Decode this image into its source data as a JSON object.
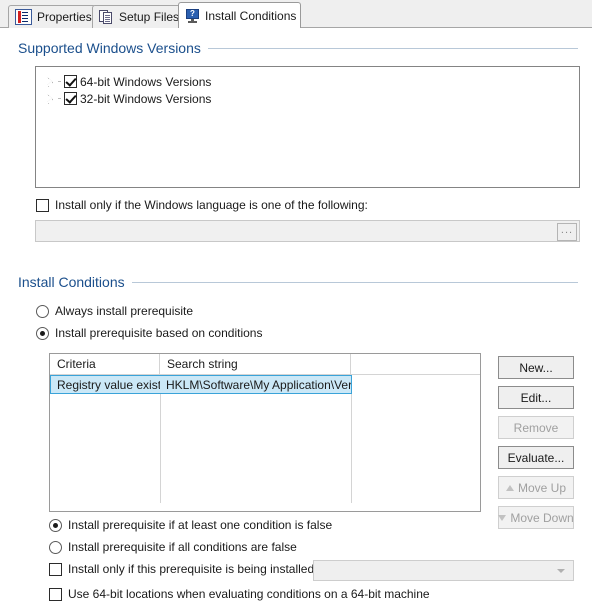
{
  "tabs": [
    {
      "label": "Properties",
      "icon": "properties-icon",
      "active": false
    },
    {
      "label": "Setup Files",
      "icon": "setup-files-icon",
      "active": false
    },
    {
      "label": "Install Conditions",
      "icon": "install-conditions-icon",
      "active": true
    }
  ],
  "supported_versions": {
    "header": "Supported Windows Versions",
    "items": [
      {
        "label": "64-bit Windows Versions",
        "checked": true,
        "expanded": false
      },
      {
        "label": "32-bit Windows Versions",
        "checked": true,
        "expanded": false
      }
    ],
    "language_option": {
      "label": "Install only if the Windows language is one of the following:",
      "checked": false
    },
    "language_field": {
      "value": "",
      "placeholder": "",
      "browse_label": "...",
      "enabled": false
    }
  },
  "install_conditions": {
    "header": "Install Conditions",
    "mode_options": [
      {
        "label": "Always install prerequisite",
        "selected": false
      },
      {
        "label": "Install prerequisite based on conditions",
        "selected": true
      }
    ],
    "grid": {
      "columns": [
        "Criteria",
        "Search string",
        ""
      ],
      "rows": [
        {
          "criteria": "Registry value exists",
          "search_string": "HKLM\\Software\\My Application\\Version",
          "selected": true
        }
      ]
    },
    "buttons": [
      {
        "label": "New...",
        "enabled": true,
        "icon": ""
      },
      {
        "label": "Edit...",
        "enabled": true,
        "icon": ""
      },
      {
        "label": "Remove",
        "enabled": false,
        "icon": ""
      },
      {
        "label": "Evaluate...",
        "enabled": true,
        "icon": ""
      },
      {
        "label": "Move Up",
        "enabled": false,
        "icon": "arrow-up-icon"
      },
      {
        "label": "Move Down",
        "enabled": false,
        "icon": "arrow-down-icon"
      }
    ],
    "evaluation_options": [
      {
        "label": "Install prerequisite if at least one condition is false",
        "selected": true
      },
      {
        "label": "Install prerequisite if all conditions are false",
        "selected": false
      }
    ],
    "dependency_option": {
      "label": "Install only if this prerequisite is being installed:",
      "checked": false
    },
    "dependency_combo": {
      "value": "",
      "enabled": false
    },
    "bitness_option": {
      "label": "Use 64-bit locations when evaluating conditions on a 64-bit machine",
      "checked": false
    }
  },
  "colors": {
    "group_header": "#1b4f8c",
    "selection_fill": "#cbe8f7",
    "selection_border": "#3aa3d9",
    "tab_strip": "#efefef"
  }
}
